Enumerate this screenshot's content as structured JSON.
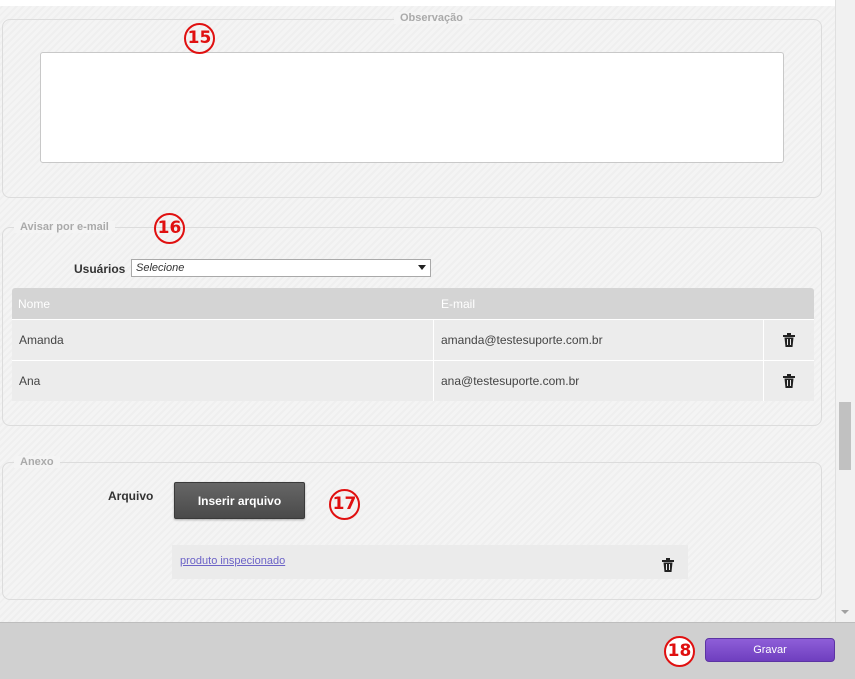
{
  "observacao": {
    "legend": "Observação",
    "textarea_value": "",
    "annotation": "15"
  },
  "email": {
    "legend": "Avisar por e-mail",
    "annotation": "16",
    "users_label": "Usuários",
    "users_select_value": "Selecione",
    "columns": [
      "Nome",
      "E-mail"
    ],
    "rows": [
      {
        "name": "Amanda",
        "email": "amanda@testesuporte.com.br"
      },
      {
        "name": "Ana",
        "email": "ana@testesuporte.com.br"
      }
    ]
  },
  "anexo": {
    "legend": "Anexo",
    "annotation": "17",
    "file_label": "Arquivo",
    "insert_button": "Inserir arquivo",
    "file_name": "produto inspecionado"
  },
  "footer": {
    "save_button": "Gravar",
    "annotation": "18"
  },
  "colors": {
    "save_accent": "#7a4acb",
    "annotation_red": "#e01010",
    "link": "#6c63c7"
  },
  "icons": {
    "delete": "trash-icon"
  }
}
